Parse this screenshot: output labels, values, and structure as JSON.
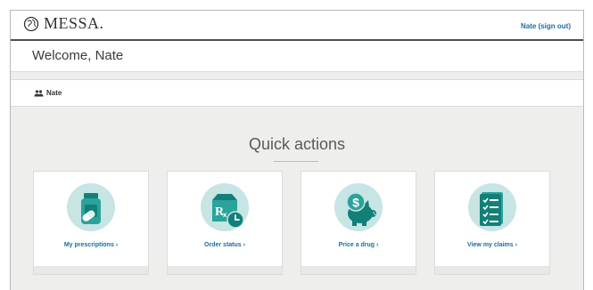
{
  "header": {
    "brand": "MESSA.",
    "user_link": "Nate (sign out)"
  },
  "welcome": {
    "text": "Welcome, Nate"
  },
  "member": {
    "name": "Nate",
    "icon": "people-icon"
  },
  "quick_actions": {
    "title": "Quick actions",
    "cards": [
      {
        "label": "My prescriptions ›",
        "icon": "pill-bottle-icon"
      },
      {
        "label": "Order status ›",
        "icon": "rx-box-clock-icon"
      },
      {
        "label": "Price a drug ›",
        "icon": "piggy-bank-icon"
      },
      {
        "label": "View my claims ›",
        "icon": "checklist-icon"
      }
    ]
  },
  "colors": {
    "accent": "#1a6e9e",
    "icon_circle": "#c6e5e4",
    "icon_dark": "#137f79",
    "icon_mid": "#2aa39a",
    "page_bg": "#eeeeed"
  }
}
